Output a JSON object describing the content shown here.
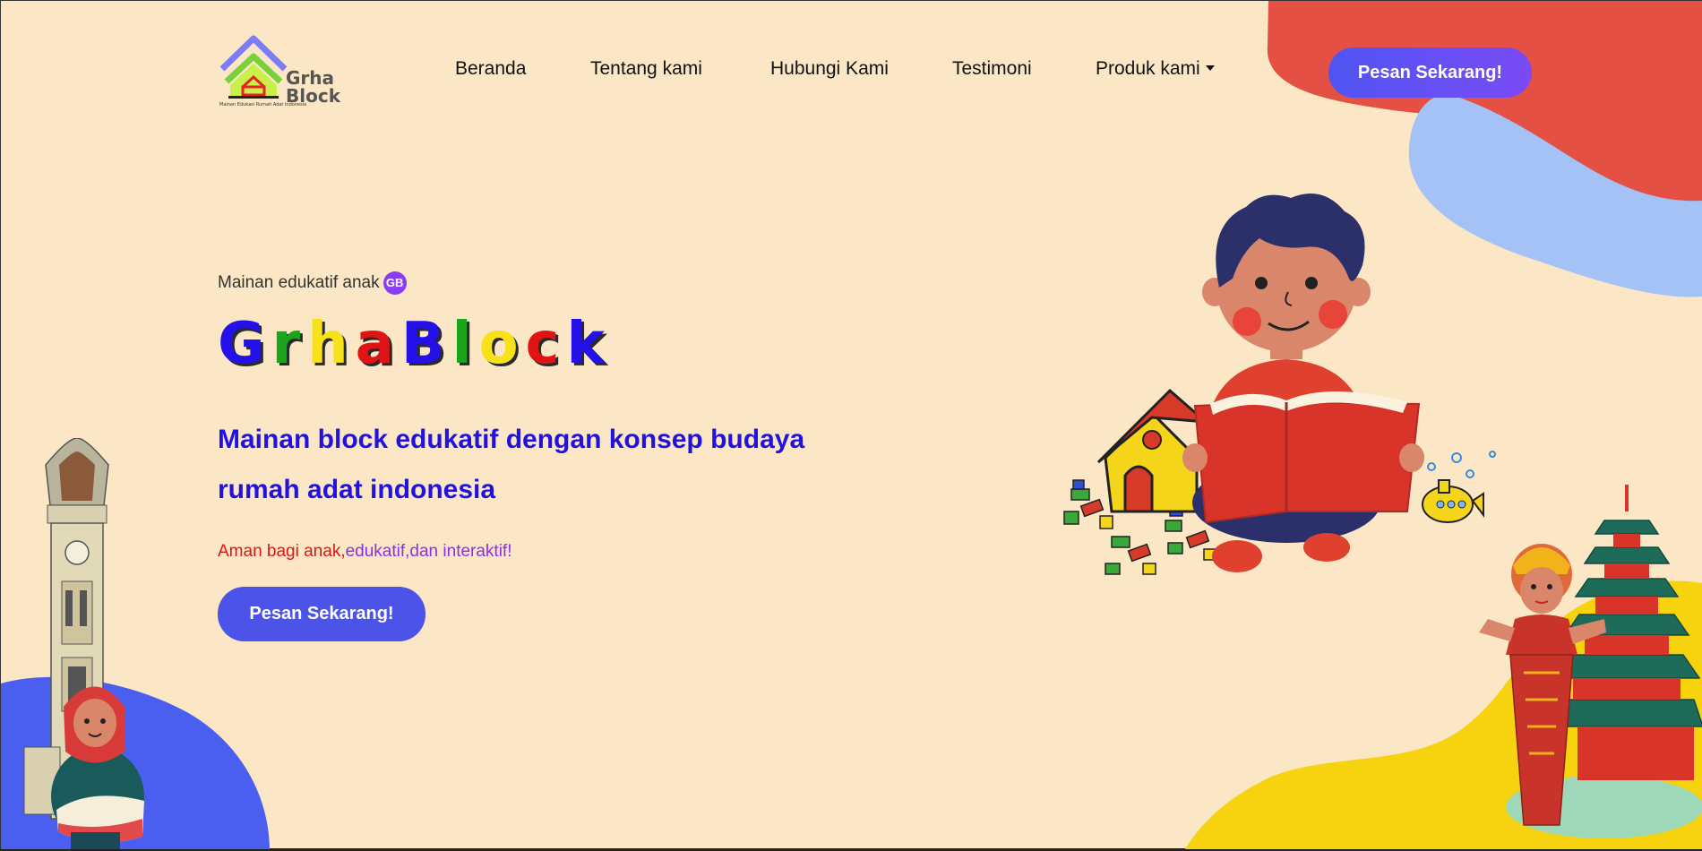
{
  "logo": {
    "name": "Grha Block",
    "tagline": "Mainan Edukasi Rumah Adat Indonesia"
  },
  "nav": {
    "items": [
      "Beranda",
      "Tentang kami",
      "Hubungi Kami",
      "Testimoni",
      "Produk kami"
    ],
    "cta": "Pesan Sekarang!"
  },
  "hero": {
    "eyebrow": "Mainan edukatif anak",
    "badge": "GB",
    "brand_letters": [
      {
        "ch": "G",
        "color": "#2410e8"
      },
      {
        "ch": "r",
        "color": "#1aa51a"
      },
      {
        "ch": "h",
        "color": "#f7e21a"
      },
      {
        "ch": "a",
        "color": "#e01414"
      },
      {
        "ch": "B",
        "color": "#2410e8"
      },
      {
        "ch": "l",
        "color": "#1aa51a"
      },
      {
        "ch": "o",
        "color": "#f7e21a"
      },
      {
        "ch": "c",
        "color": "#e01414"
      },
      {
        "ch": "k",
        "color": "#2410e8"
      }
    ],
    "headline": "Mainan block edukatif dengan konsep budaya rumah adat indonesia",
    "tagline": {
      "part1": "Aman bagi anak,",
      "part2": "edukatif,",
      "part3": "dan interaktif!"
    },
    "cta": "Pesan Sekarang!"
  },
  "colors": {
    "background": "#fbe7c6",
    "blob_red": "#e45044",
    "blob_lightblue": "#a4c2f5",
    "blob_blue": "#4a5ef0",
    "blob_yellow": "#f6d20f",
    "button": "#4b53e8",
    "headline": "#2212e0"
  },
  "illustrations": [
    "boy-reading-book-illustration",
    "minangkabau-woman-clock-tower-illustration",
    "balinese-dancer-pagoda-illustration"
  ]
}
